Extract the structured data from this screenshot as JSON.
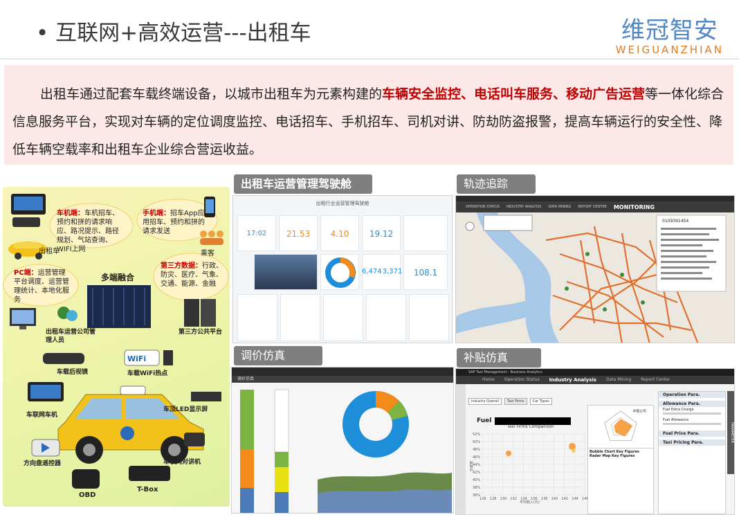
{
  "title": "• 互联网+高效运营---出租车",
  "logo": {
    "cn": "维冠智安",
    "en": "WEIGUANZHIAN"
  },
  "intro": {
    "part1": "出租车通过配套车载终端设备，以城市出租车为元素构建的",
    "highlight": "车辆安全监控、电话叫车服务、移动广告运营",
    "part2": "等一体化综合信息服务平台，实现对车辆的定位调度监控、电话招车、手机招车、司机对讲、防劫防盗报警，提高车辆运行的安全性、降低车辆空载率和出租车企业综合营运收益。"
  },
  "diagram": {
    "car_terminal_title": "车机端：",
    "car_terminal_text": "车机招车、预约和拼的请求响应、路况提示、路径规划、气站查询、WIFI上网",
    "mobile_title": "手机端：",
    "mobile_text": "招车App应用招车、预约和拼的请求发送",
    "pc_title": "PC端：",
    "pc_text": "运营管理平台调度、运营管理统计、本地化服务",
    "third_title": "第三方数据：",
    "third_text": "行政、防灾、医疗、气象、交通、能源、金融",
    "taxi": "出租车",
    "passenger": "乘客",
    "fusion": "多端融合",
    "ops_staff": "出租车运营公司管理人员",
    "third_platform": "第三方公共平台",
    "rear_mirror": "车载后视镜",
    "wifi_spot": "车载WiFi热点",
    "car_radio": "车联网车机",
    "led_screen": "车顶LED显示屏",
    "wheel_ctrl": "方向盘遥控器",
    "intercom": "车联网对讲机",
    "obd": "OBD",
    "tbox": "T-Box"
  },
  "panels": {
    "cockpit": {
      "label": "出租车运营管理驾驶舱",
      "header": "出租行业运营管理驾驶舱",
      "kpis": [
        "17:02",
        "21.53",
        "4.10",
        "19.12",
        "6,474",
        "3,371",
        "108.1"
      ]
    },
    "tracking": {
      "label": "轨迹追踪",
      "nav": [
        "OPERATION STATUS",
        "INDUSTRY ANALYSIS",
        "DATA MINING",
        "REPORT CENTER"
      ],
      "nav_active": "MONITORING",
      "plate": "0109391454"
    },
    "pricing": {
      "label": "调价仿真",
      "tab": "调价仿真"
    },
    "subsidy": {
      "label": "补贴仿真",
      "app_title": "SAP Taxi Management - Business Analytics",
      "nav": [
        "Home",
        "Operation Status",
        "Industry Analysis",
        "Data Mining",
        "Report Center"
      ],
      "nav_active": "Industry Analysis",
      "tabs": [
        "Industry Overall",
        "Taxi Firms",
        "Car Types"
      ],
      "chart_title": "Taxi Firms Comparison",
      "fuel": "Fuel",
      "radar_label": "中低公司",
      "key1": "Bubble Chart Key Figures",
      "key2": "Radar Map Key Figures",
      "params": [
        "Operation Para.",
        "Allowance Para.",
        "Fuel Price Para.",
        "Taxi Pricing Para."
      ],
      "param_items": [
        "Fuel Extra Charge",
        "Fuel Allowance"
      ],
      "side": "PARAMETER",
      "x_ticks": [
        "126",
        "128",
        "130",
        "132",
        "134",
        "136",
        "138",
        "140",
        "142",
        "144",
        "146"
      ],
      "y_ticks": [
        "52%",
        "50%",
        "48%",
        "46%",
        "44%",
        "42%",
        "40%",
        "38%",
        "36%"
      ],
      "xlabel": "平均收入(元)",
      "ylabel": "空驶率"
    }
  }
}
